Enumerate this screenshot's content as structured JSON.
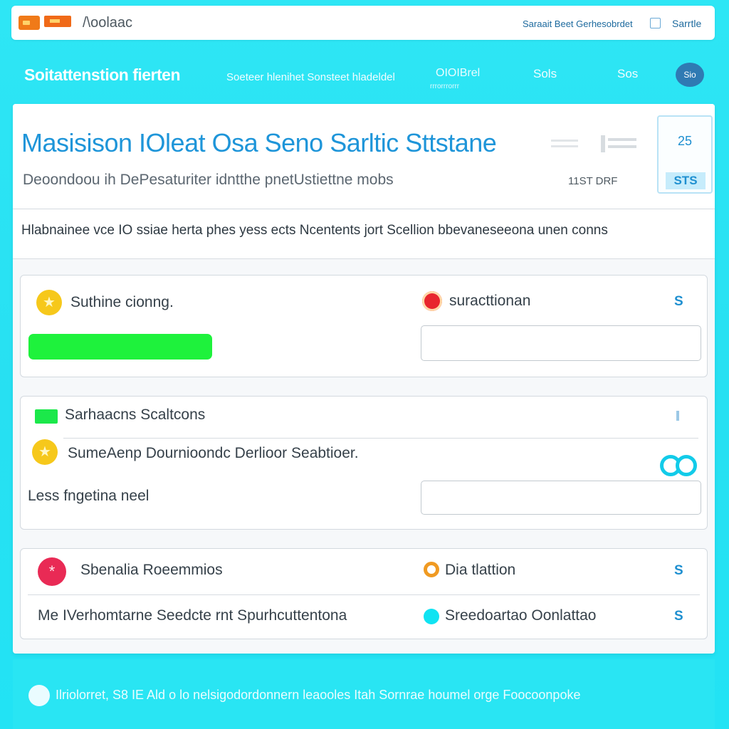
{
  "topbar": {
    "app_title": "/\\oolaac",
    "link": "Saraait Beet Gerhesobrdet",
    "search_label": "Sarrtle"
  },
  "header": {
    "brand": "Soitattenstion fierten",
    "nav": [
      {
        "label": "Soeteer hlenihet Sonsteet hladeldel"
      },
      {
        "label": "OIOIBrel",
        "sub": "rrrorrrorrr"
      },
      {
        "label": "Sols"
      },
      {
        "label": "Sos"
      }
    ],
    "avatar_text": "Sio"
  },
  "panel": {
    "title": "Masisison IOleat Osa Seno Sarltic Sttstane",
    "subtitle": "Deoondoou ih DePesaturiter idntthe pnetUstiettne mobs",
    "date_label": "11ST DRF",
    "stat": {
      "value": "25",
      "label": "STS"
    },
    "description": "Hlabnainee vce IO ssiae herta phes yess ects Ncentents jort Scellion bbevaneseeona unen conns"
  },
  "cards": {
    "card1": {
      "left_label": "Suthine cionng.",
      "right_label": "suracttionan",
      "badge": "S"
    },
    "card2": {
      "header_label": "Sarhaacns Scaltcons",
      "row_label": "SumeAenp Dournioondc Derlioor Seabtioer.",
      "field_label": "Less fngetina neel"
    },
    "card3": {
      "row1_left": "Sbenalia Roeemmios",
      "row1_right": "Dia tlattion",
      "row1_badge": "S",
      "row2_left": "Me IVerhomtarne Seedcte rnt Spurhcuttentona",
      "row2_right": "Sreedoartao Oonlattao",
      "row2_badge": "S"
    }
  },
  "footer": {
    "text": "Ilriolorret, S8 IE Ald o lo nelsigodordonnern leaooles Itah Sornrae houmel orge Foocoonpoke"
  },
  "colors": {
    "background": "#2ee6f5",
    "accent": "#1e95d9",
    "success": "#1ef23c",
    "warning": "#f6c81b",
    "danger": "#e8262e"
  },
  "icons": [
    "logo-icon",
    "checkbox-icon",
    "star-icon",
    "status-dot-icon",
    "toggle-icon"
  ]
}
